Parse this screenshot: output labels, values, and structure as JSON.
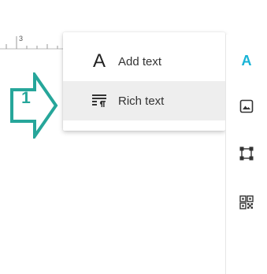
{
  "ruler": {
    "label": "3"
  },
  "callout": {
    "number": "1",
    "color": "#26a69a"
  },
  "menu": {
    "items": [
      {
        "label": "Add text",
        "icon": "letter-a-icon",
        "glyph": "A"
      },
      {
        "label": "Rich text",
        "icon": "rich-text-icon"
      }
    ]
  },
  "toolbar": {
    "accent": "#17b3d6",
    "tools": [
      {
        "name": "text-tool",
        "icon": "letter-a-icon",
        "glyph": "A"
      },
      {
        "name": "image-tool",
        "icon": "image-icon"
      },
      {
        "name": "shape-tool",
        "icon": "shape-icon"
      },
      {
        "name": "qr-tool",
        "icon": "qr-code-icon"
      }
    ]
  }
}
